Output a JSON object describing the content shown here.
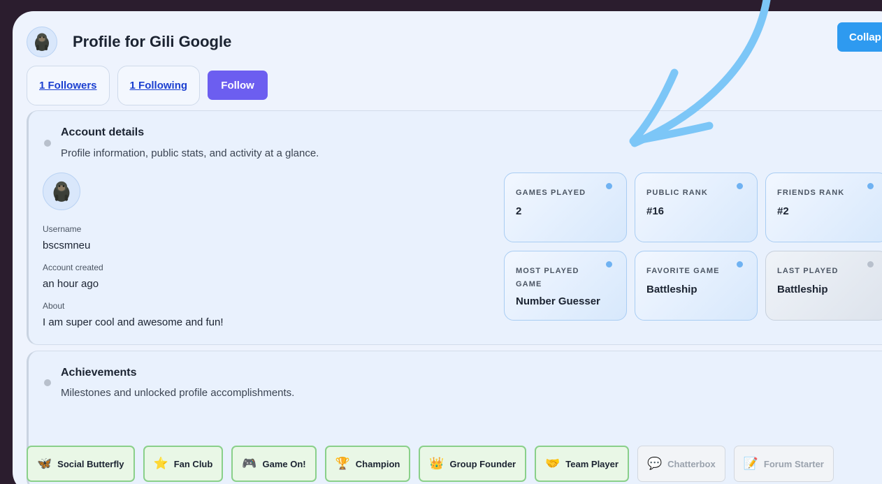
{
  "header": {
    "title": "Profile for Gili Google",
    "collapse_label": "Collap"
  },
  "social": {
    "followers": "1 Followers",
    "following": "1 Following",
    "follow_label": "Follow"
  },
  "account": {
    "title": "Account details",
    "description": "Profile information, public stats, and activity at a glance.",
    "username_label": "Username",
    "username": "bscsmneu",
    "created_label": "Account created",
    "created": "an hour ago",
    "about_label": "About",
    "about": "I am super cool and awesome and fun!"
  },
  "stats": [
    {
      "label": "Games Played",
      "value": "2",
      "active": true
    },
    {
      "label": "Public Rank",
      "value": "#16",
      "active": true
    },
    {
      "label": "Friends Rank",
      "value": "#2",
      "active": true
    },
    {
      "label": "Most Played Game",
      "value": "Number Guesser",
      "active": true
    },
    {
      "label": "Favorite Game",
      "value": "Battleship",
      "active": true
    },
    {
      "label": "Last Played",
      "value": "Battleship",
      "active": false
    }
  ],
  "achievements": {
    "title": "Achievements",
    "description": "Milestones and unlocked profile accomplishments.",
    "badges": [
      {
        "label": "Social Butterfly",
        "icon": "butterfly-icon",
        "glyph": "🦋",
        "unlocked": true
      },
      {
        "label": "Fan Club",
        "icon": "star-icon",
        "glyph": "⭐",
        "unlocked": true
      },
      {
        "label": "Game On!",
        "icon": "gamepad-icon",
        "glyph": "🎮",
        "unlocked": true
      },
      {
        "label": "Champion",
        "icon": "trophy-icon",
        "glyph": "🏆",
        "unlocked": true
      },
      {
        "label": "Group Founder",
        "icon": "crown-icon",
        "glyph": "👑",
        "unlocked": true
      },
      {
        "label": "Team Player",
        "icon": "handshake-icon",
        "glyph": "🤝",
        "unlocked": true
      },
      {
        "label": "Chatterbox",
        "icon": "speech-bubble-icon",
        "glyph": "💬",
        "unlocked": false
      },
      {
        "label": "Forum Starter",
        "icon": "memo-icon",
        "glyph": "📝",
        "unlocked": false
      }
    ]
  },
  "colors": {
    "accent": "#2e9af0",
    "follow": "#6c5ef0",
    "unlocked_border": "#8ad08a",
    "arrow": "#7cc6f7"
  }
}
